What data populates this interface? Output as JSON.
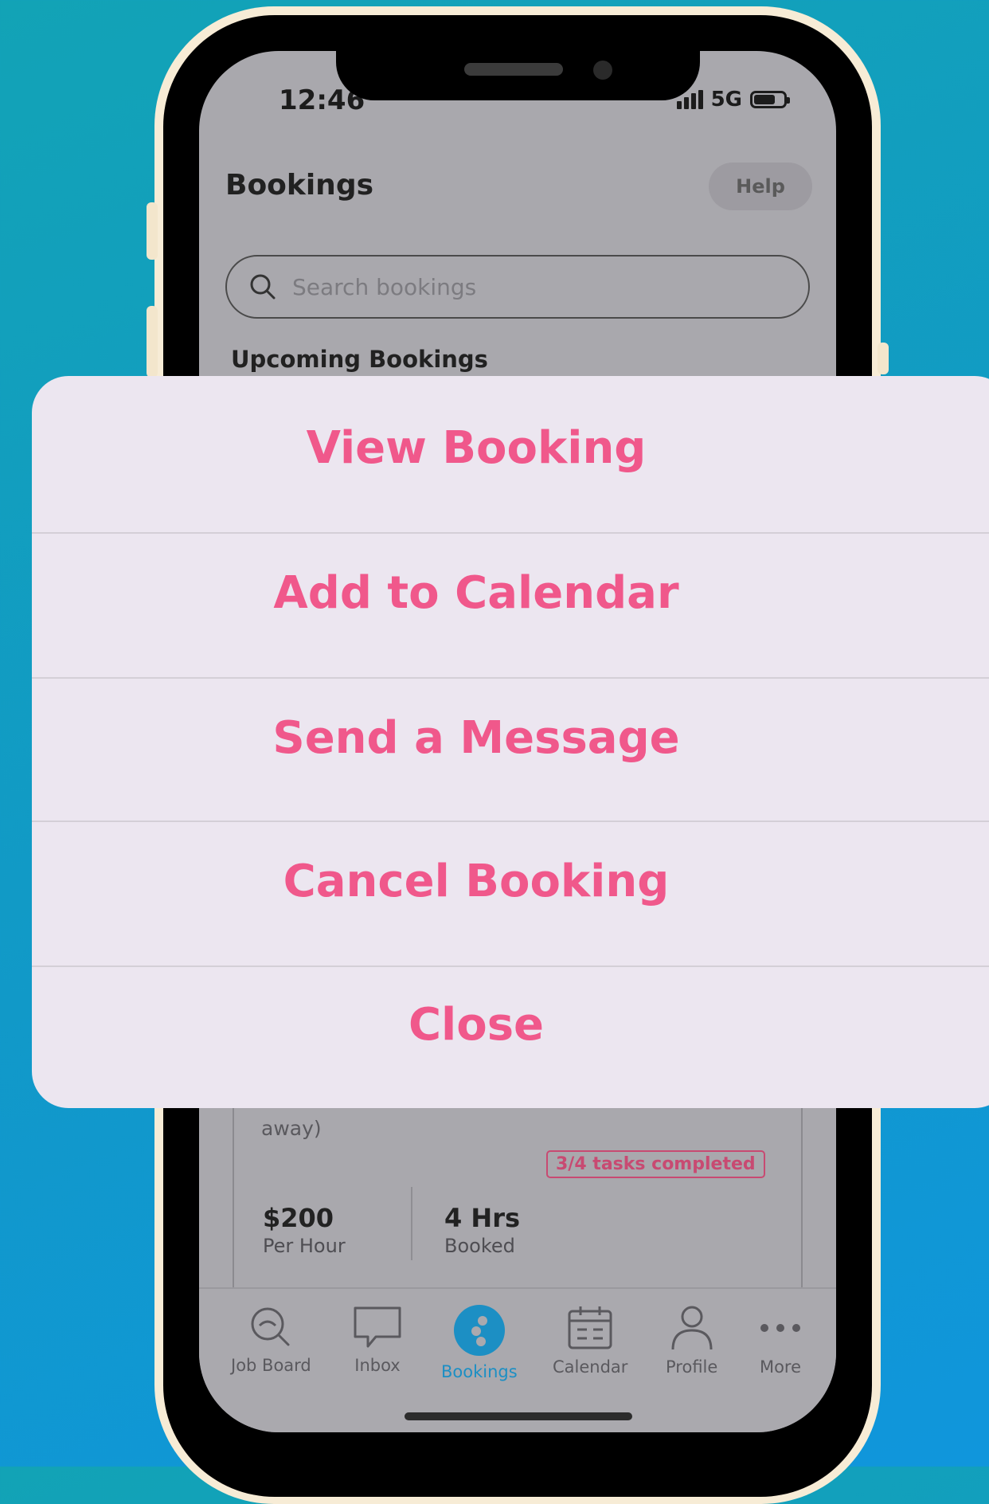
{
  "status_bar": {
    "time": "12:46",
    "network": "5G"
  },
  "header": {
    "title": "Bookings",
    "help_label": "Help"
  },
  "search": {
    "placeholder": "Search bookings"
  },
  "section_title": "Upcoming Bookings",
  "booking_card": {
    "address_tail": "away)",
    "tasks_badge": "3/4 tasks completed",
    "rate_value": "$200",
    "rate_label": "Per Hour",
    "hours_value": "4 Hrs",
    "hours_label": "Booked"
  },
  "tab_bar": {
    "items": [
      {
        "label": "Job Board",
        "icon": "search-icon"
      },
      {
        "label": "Inbox",
        "icon": "chat-bubble-icon"
      },
      {
        "label": "Bookings",
        "icon": "bookings-logo-icon",
        "active": true
      },
      {
        "label": "Calendar",
        "icon": "calendar-icon"
      },
      {
        "label": "Profile",
        "icon": "person-icon"
      },
      {
        "label": "More",
        "icon": "more-dots-icon"
      }
    ],
    "active_color": "#1c8fc4"
  },
  "action_sheet": {
    "items": [
      {
        "label": "View Booking"
      },
      {
        "label": "Add to Calendar"
      },
      {
        "label": "Send a Message"
      },
      {
        "label": "Cancel Booking"
      },
      {
        "label": "Close"
      }
    ],
    "accent_color": "#f0588b"
  },
  "colors": {
    "background": "#1199c8",
    "phone_frame": "#f7ecd6"
  }
}
